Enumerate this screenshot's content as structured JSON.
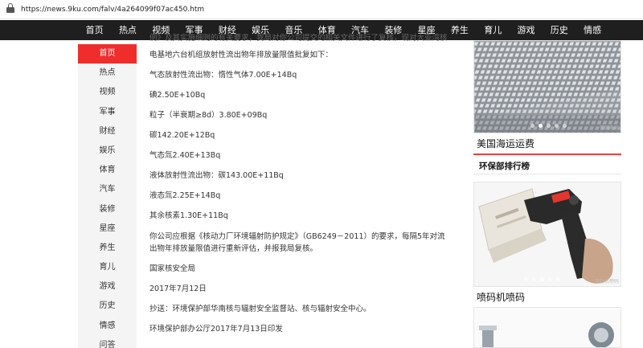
{
  "browser": {
    "url": "https://news.9ku.com/falv/4a264099f07ac450.htm"
  },
  "topnav": [
    "首页",
    "热点",
    "视频",
    "军事",
    "财经",
    "娱乐",
    "音乐",
    "体育",
    "汽车",
    "装修",
    "星座",
    "养生",
    "育儿",
    "游戏",
    "历史",
    "情感"
  ],
  "leftnav": [
    "首页",
    "热点",
    "视频",
    "军事",
    "财经",
    "娱乐",
    "体育",
    "汽车",
    "装修",
    "星座",
    "养生",
    "育儿",
    "游戏",
    "历史",
    "情感",
    "问答"
  ],
  "article": {
    "lines": [
      "例》及其实施细则的有关要求，我局对你公司提交的相关文件进行了复核，现对大亚湾核",
      "电基地六台机组放射性流出物年排放量限值批复如下：",
      "气态放射性流出物：惰性气体7.00E+14Bq",
      "碘2.50E+10Bq",
      "粒子（半衰期≥8d）3.80E+09Bq",
      "碳142.20E+12Bq",
      "气态氚2.40E+13Bq",
      "液体放射性流出物：碳143.00E+11Bq",
      "液态氚2.25E+14Bq",
      "其余核素1.30E+11Bq",
      "你公司应根据《核动力厂环境辐射防护规定》（GB6249－2011）的要求，每隔5年对流",
      "出物年排放量限值进行重新评估，并报我局复核。",
      "国家核安全局",
      "2017年7月12日",
      "抄送：环境保护部华南核与辐射安全监督站、核与辐射安全中心。",
      "环境保护部办公厅2017年7月13日印发"
    ]
  },
  "sidebar": {
    "card1_caption": "美国海运运费",
    "card1_tag": "美国海运",
    "rank_title": "环保部排行榜",
    "card2_caption": "喷码机喷码",
    "card2_tag": "喷码机喷码"
  },
  "colors": {
    "nav_bg": "#1f1f1f",
    "accent": "#f02d2d",
    "left_bg": "#f4f4f4"
  }
}
